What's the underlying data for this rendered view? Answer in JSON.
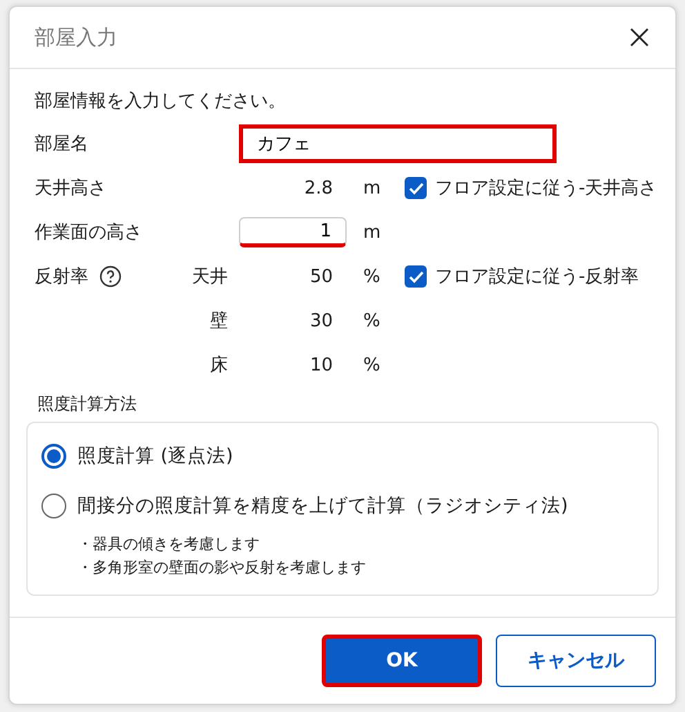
{
  "window": {
    "title": "部屋入力"
  },
  "intro": "部屋情報を入力してください。",
  "room_name": {
    "label": "部屋名",
    "value": "カフェ",
    "highlighted": true
  },
  "ceiling_height": {
    "label": "天井高さ",
    "value": "2.8",
    "unit": "m",
    "follow_floor": {
      "label": "フロア設定に従う-天井高さ",
      "checked": true
    }
  },
  "work_plane_height": {
    "label": "作業面の高さ",
    "value": "1",
    "unit": "m",
    "underlined": true
  },
  "reflectance": {
    "label": "反射率",
    "follow_floor": {
      "label": "フロア設定に従う-反射率",
      "checked": true
    },
    "rows": [
      {
        "surface": "天井",
        "value": "50",
        "unit": "%"
      },
      {
        "surface": "壁",
        "value": "30",
        "unit": "%"
      },
      {
        "surface": "床",
        "value": "10",
        "unit": "%"
      }
    ]
  },
  "calculation_method": {
    "label": "照度計算方法",
    "options": [
      {
        "label": "照度計算 (逐点法)",
        "selected": true
      },
      {
        "label": "間接分の照度計算を精度を上げて計算（ラジオシティ法)",
        "selected": false
      }
    ],
    "notes": [
      "・器具の傾きを考慮します",
      "・多角形室の壁面の影や反射を考慮します"
    ]
  },
  "buttons": [
    {
      "label": "OK",
      "kind": "primary",
      "highlighted": true
    },
    {
      "label": "キャンセル",
      "kind": "secondary",
      "highlighted": false
    }
  ]
}
